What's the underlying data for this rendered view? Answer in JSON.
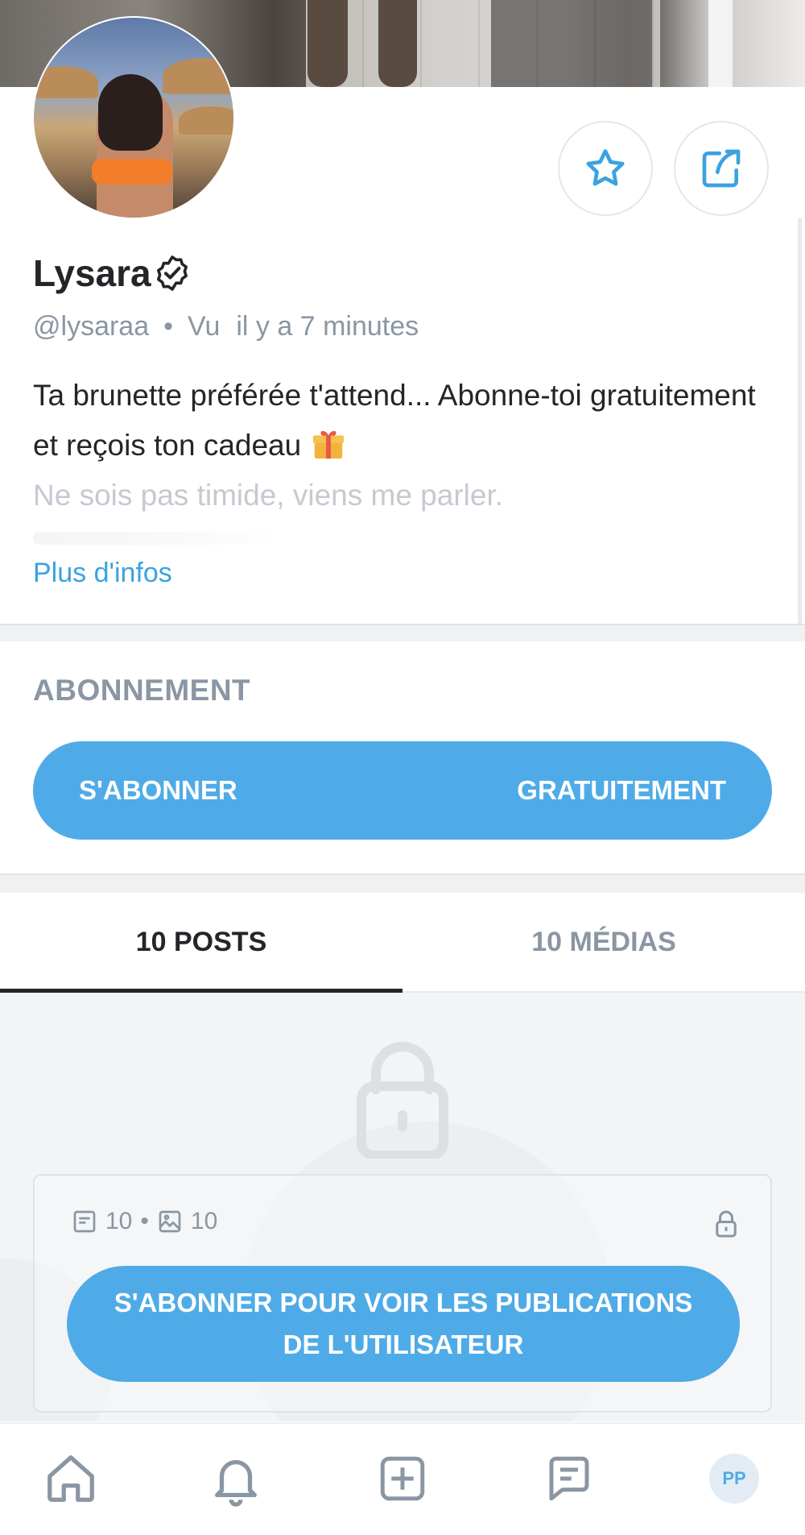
{
  "profile": {
    "name": "Lysara",
    "handle": "@lysaraa",
    "meta_separator": "•",
    "seen_label": "Vu",
    "last_seen": "il y a 7 minutes",
    "bio_line": "Ta brunette préférée t'attend... Abonne-toi gratuitement et reçois ton cadeau",
    "bio_emoji": "gift-emoji",
    "bio_faded": "Ne sois pas timide, viens me parler.",
    "more_link": "Plus d'infos"
  },
  "actions": {
    "favorite_icon": "star-icon",
    "share_icon": "share-icon"
  },
  "subscription": {
    "title": "ABONNEMENT",
    "button_left": "S'ABONNER",
    "button_right": "GRATUITEMENT"
  },
  "tabs": [
    {
      "label": "10 POSTS",
      "active": true
    },
    {
      "label": "10 MÉDIAS",
      "active": false
    }
  ],
  "locked": {
    "posts_count": "10",
    "media_count": "10",
    "separator": "•",
    "button_label": "S'ABONNER POUR VOIR LES PUBLICATIONS DE L'UTILISATEUR"
  },
  "nav": {
    "items": [
      "home-icon",
      "bell-icon",
      "add-post-icon",
      "messages-icon"
    ],
    "avatar_initials": "PP"
  },
  "colors": {
    "accent": "#4fabe7",
    "link": "#3aa3e0",
    "muted": "#8a96a3",
    "text": "#242529"
  }
}
